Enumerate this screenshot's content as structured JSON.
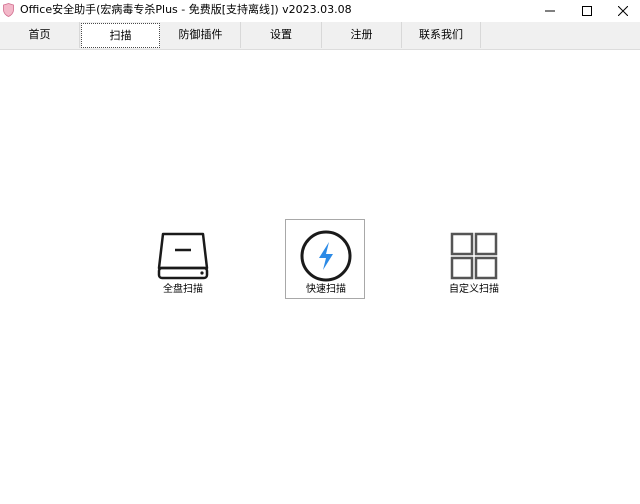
{
  "window": {
    "title": "Office安全助手(宏病毒专杀Plus - 免费版[支持离线]) v2023.03.08",
    "minimize_icon": "minimize-icon",
    "maximize_icon": "maximize-icon",
    "close_icon": "close-icon"
  },
  "tabs": [
    {
      "label": "首页",
      "active": false
    },
    {
      "label": "扫描",
      "active": true
    },
    {
      "label": "防御插件",
      "active": false
    },
    {
      "label": "设置",
      "active": false
    },
    {
      "label": "注册",
      "active": false
    },
    {
      "label": "联系我们",
      "active": false
    }
  ],
  "scan_options": [
    {
      "label": "全盘扫描",
      "icon": "hard-drive-icon",
      "selected": false
    },
    {
      "label": "快速扫描",
      "icon": "lightning-icon",
      "selected": true,
      "accent": "#2b8ae6"
    },
    {
      "label": "自定义扫描",
      "icon": "grid-icon",
      "selected": false
    }
  ]
}
